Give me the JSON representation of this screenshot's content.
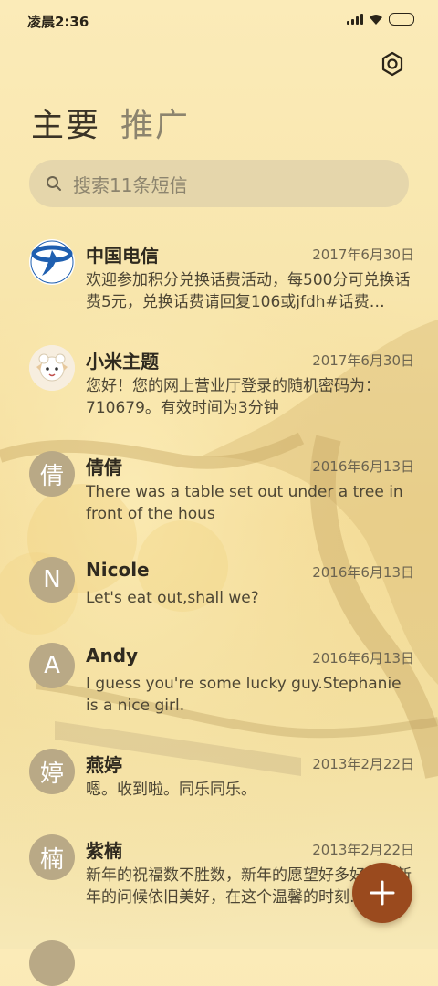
{
  "status_bar": {
    "time": "凌晨2:36"
  },
  "tabs": [
    {
      "label": "主要",
      "active": true
    },
    {
      "label": "推广",
      "active": false
    }
  ],
  "search": {
    "placeholder": "搜索11条短信"
  },
  "conversations": [
    {
      "name": "中国电信",
      "date": "2017年6月30日",
      "preview": "欢迎参加积分兑换话费活动，每500分可兑换话费5元，兑换话费请回复106或jfdh#话费…",
      "avatar_icon": "china-telecom-logo"
    },
    {
      "name": "小米主题",
      "date": "2017年6月30日",
      "preview": "您好！您的网上营业厅登录的随机密码为：710679。有效时间为3分钟",
      "avatar_icon": "cartoon-sheep-avatar"
    },
    {
      "name": "倩倩",
      "date": "2016年6月13日",
      "preview": "There was a table set out under a tree in front of the hous",
      "avatar_letter": "倩"
    },
    {
      "name": "Nicole",
      "date": "2016年6月13日",
      "preview": "Let's eat out,shall we?",
      "avatar_letter": "N"
    },
    {
      "name": "Andy",
      "date": "2016年6月13日",
      "preview": "I guess you're some lucky guy.Stephanie is a nice girl.",
      "avatar_letter": "A"
    },
    {
      "name": "燕婷",
      "date": "2013年2月22日",
      "preview": "嗯。收到啦。同乐同乐。",
      "avatar_letter": "婷"
    },
    {
      "name": "紫楠",
      "date": "2013年2月22日",
      "preview": "新年的祝福数不胜数，新年的愿望好多好多，新年的问候依旧美好，在这个温馨的时刻…",
      "avatar_letter": "楠"
    }
  ],
  "fab": {
    "icon": "plus-icon"
  },
  "colors": {
    "background": "#f8e6ad",
    "fab": "#9a4a1e",
    "avatar": "#b9a986",
    "telecom_blue": "#1f5fb0"
  }
}
